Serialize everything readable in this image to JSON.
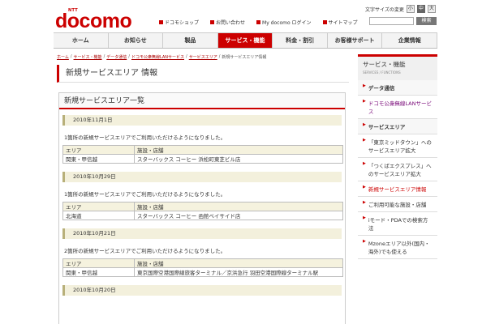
{
  "header": {
    "ntt": "NTT",
    "logo": "docomo",
    "font_size_label": "文字サイズの変更",
    "font_sizes": [
      "小",
      "中",
      "大"
    ],
    "links": [
      "ドコモショップ",
      "お問い合わせ",
      "My docomo ログイン",
      "サイトマップ"
    ],
    "search_button": "検索"
  },
  "nav": {
    "tabs": [
      "ホーム",
      "お知らせ",
      "製品",
      "サービス・機能",
      "料金・割引",
      "お客様サポート",
      "企業情報"
    ],
    "active": "サービス・機能"
  },
  "breadcrumb": [
    "ホーム",
    "サービス・機能",
    "データ通信",
    "ドコモ公衆無線LANサービス",
    "サービスエリア",
    "新規サービスエリア情報"
  ],
  "page_title": "新規サービスエリア 情報",
  "section_title": "新規サービスエリア一覧",
  "table_headers": [
    "エリア",
    "施設・店舗"
  ],
  "entries": [
    {
      "date": "2010年11月1日",
      "msg": "1箇所の新規サービスエリアでご利用いただけるようになりました。",
      "area": "関東・甲信越",
      "place": "スターバックス コーヒー 浜松町東芝ビル店"
    },
    {
      "date": "2010年10月29日",
      "msg": "1箇所の新規サービスエリアでご利用いただけるようになりました。",
      "area": "北海道",
      "place": "スターバックス コーヒー 函館ベイサイド店"
    },
    {
      "date": "2010年10月21日",
      "msg": "2箇所の新規サービスエリアでご利用いただけるようになりました。",
      "area": "関東・甲信越",
      "place": "東京国際空港国際線旅客ターミナル／京浜急行 羽田空港国際線ターミナル駅"
    },
    {
      "date": "2010年10月20日"
    }
  ],
  "sidebar": {
    "title": "サービス・機能",
    "subtitle": "SERVICES / FUNCTIONS",
    "items": [
      {
        "label": "データ通信",
        "type": "bold"
      },
      {
        "label": "ドコモ公衆無線LANサービス",
        "type": "link"
      },
      {
        "label": "サービスエリア",
        "type": "bold"
      },
      {
        "label": "「東京ミッドタウン」へのサービスエリア拡大",
        "type": "normal"
      },
      {
        "label": "「つくばエクスプレス」へのサービスエリア拡大",
        "type": "normal"
      },
      {
        "label": "新規サービスエリア情報",
        "type": "sel"
      },
      {
        "label": "ご利用可能な施設・店舗",
        "type": "normal"
      },
      {
        "label": "iモード・PDAでの検索方法",
        "type": "normal"
      },
      {
        "label": "Mzoneエリア以外(国内・海外)でも使える",
        "type": "normal"
      }
    ]
  },
  "colors": {
    "brand": "#cc0000"
  }
}
